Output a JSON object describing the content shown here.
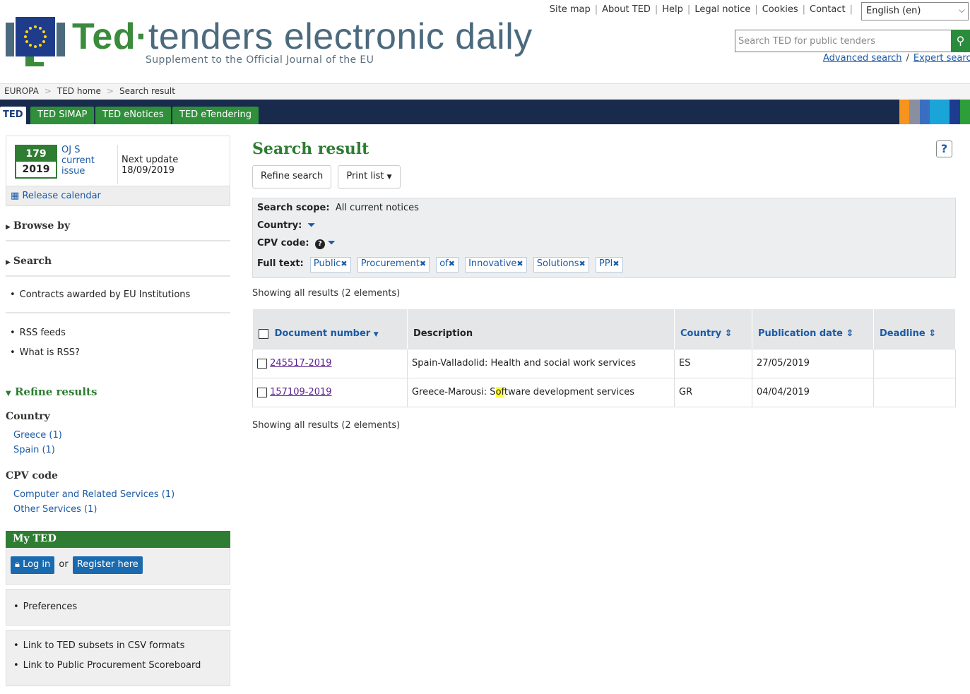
{
  "header": {
    "brand_ted": "Ted",
    "brand_rest": "tenders electronic daily",
    "tagline": "Supplement to the Official Journal of the EU",
    "top_links": [
      "Site map",
      "About TED",
      "Help",
      "Legal notice",
      "Cookies",
      "Contact"
    ],
    "language": "English (en)",
    "search_placeholder": "Search TED for public tenders",
    "advanced_search": "Advanced search",
    "expert_search": "Expert search"
  },
  "breadcrumb": [
    "EUROPA",
    "TED home",
    "Search result"
  ],
  "tabs": [
    "TED",
    "TED SIMAP",
    "TED eNotices",
    "TED eTendering"
  ],
  "colors": {
    "green": "#2e7d32",
    "navy": "#182b4d",
    "link": "#1a5aa6",
    "stripes": [
      "#f7941d",
      "#8a8fa0",
      "#3a6ec2",
      "#1ba4d8",
      "#1ba4d8",
      "#1d3c8f",
      "#2e9e3a"
    ]
  },
  "sidebar": {
    "oj_number": "179",
    "oj_year": "2019",
    "oj_label": "OJ S current issue",
    "next_update_label": "Next update",
    "next_update_date": "18/09/2019",
    "release_calendar": "Release calendar",
    "browse_by": "Browse by",
    "search": "Search",
    "contracts_awarded": "Contracts awarded by EU Institutions",
    "rss_feeds": "RSS feeds",
    "what_is_rss": "What is RSS?",
    "refine_results": "Refine results",
    "country_head": "Country",
    "countries": [
      "Greece (1)",
      "Spain (1)"
    ],
    "cpv_head": "CPV code",
    "cpv_codes": [
      "Computer and Related Services (1)",
      "Other Services (1)"
    ],
    "myted_head": "My TED",
    "login": "Log in",
    "or": "or",
    "register": "Register here",
    "preferences": "Preferences",
    "link_csv": "Link to TED subsets in CSV formats",
    "link_scoreboard": "Link to Public Procurement Scoreboard"
  },
  "main": {
    "title": "Search result",
    "help": "?",
    "refine_search": "Refine search",
    "print_list": "Print list",
    "scope_label": "Search scope:",
    "scope_value": "All current notices",
    "country_label": "Country:",
    "cpv_label": "CPV code:",
    "fulltext_label": "Full text:",
    "chips": [
      "Public",
      "Procurement",
      "of",
      "Innovative",
      "Solutions",
      "PPI"
    ],
    "showing": "Showing all results (2 elements)",
    "columns": [
      "Document number",
      "Description",
      "Country",
      "Publication date",
      "Deadline"
    ],
    "rows": [
      {
        "doc": "245517-2019",
        "desc": "Spain-Valladolid: Health and social work services",
        "country": "ES",
        "date": "27/05/2019",
        "deadline": ""
      },
      {
        "doc": "157109-2019",
        "desc_pre": "Greece-Marousi: S",
        "desc_hl": "of",
        "desc_post": "tware development services",
        "country": "GR",
        "date": "04/04/2019",
        "deadline": ""
      }
    ]
  }
}
